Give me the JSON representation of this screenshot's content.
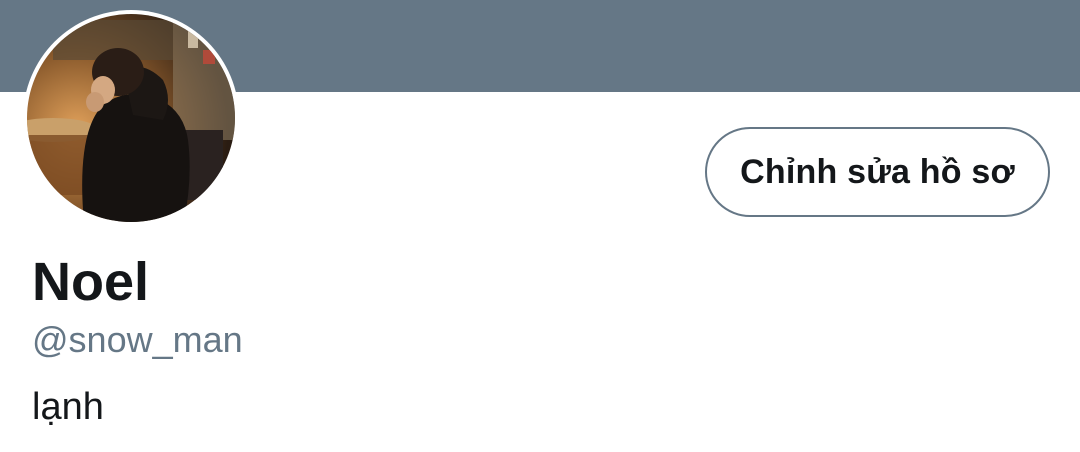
{
  "profile": {
    "name": "Noel",
    "handle": "@snow_man",
    "bio": "lạnh",
    "edit_button_label": "Chỉnh sửa hồ sơ"
  },
  "colors": {
    "banner": "#657786",
    "text_primary": "#14171a",
    "text_secondary": "#657786",
    "button_border": "#657786"
  },
  "icons": {
    "avatar": "profile-photo"
  }
}
